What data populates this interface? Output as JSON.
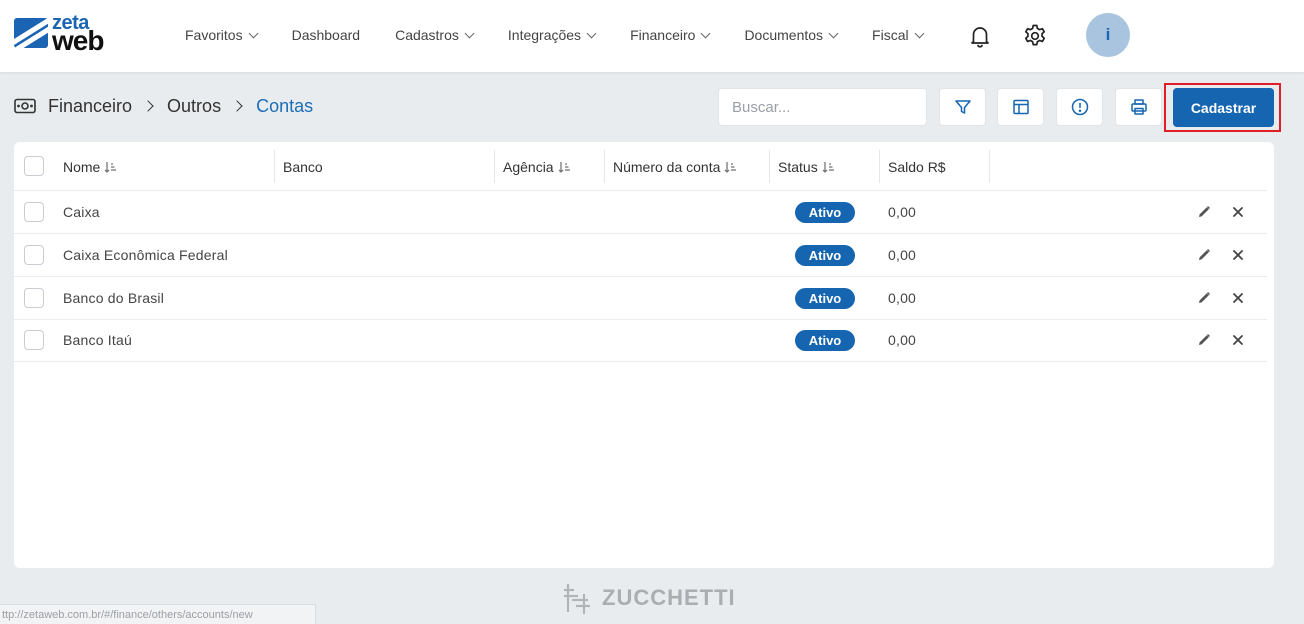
{
  "brand": {
    "line1": "zeta",
    "line2": "web"
  },
  "nav": {
    "items": [
      {
        "label": "Favoritos",
        "dropdown": true
      },
      {
        "label": "Dashboard",
        "dropdown": false
      },
      {
        "label": "Cadastros",
        "dropdown": true
      },
      {
        "label": "Integrações",
        "dropdown": true
      },
      {
        "label": "Financeiro",
        "dropdown": true
      },
      {
        "label": "Documentos",
        "dropdown": true
      },
      {
        "label": "Fiscal",
        "dropdown": true
      }
    ],
    "icons": [
      "bell-icon",
      "gear-icon"
    ],
    "avatar_initial": "i"
  },
  "breadcrumb": {
    "icon": "money-icon",
    "items": [
      "Financeiro",
      "Outros",
      "Contas"
    ]
  },
  "toolbar": {
    "search_placeholder": "Buscar...",
    "buttons": [
      "filter-icon",
      "layout-columns-icon",
      "info-icon",
      "print-icon"
    ],
    "primary_label": "Cadastrar"
  },
  "table": {
    "columns": [
      "Nome",
      "Banco",
      "Agência",
      "Número da conta",
      "Status",
      "Saldo R$"
    ],
    "rows": [
      {
        "nome": "Caixa",
        "banco": "",
        "agencia": "",
        "numero": "",
        "status": "Ativo",
        "saldo": "0,00"
      },
      {
        "nome": "Caixa Econômica Federal",
        "banco": "",
        "agencia": "",
        "numero": "",
        "status": "Ativo",
        "saldo": "0,00"
      },
      {
        "nome": "Banco do Brasil",
        "banco": "",
        "agencia": "",
        "numero": "",
        "status": "Ativo",
        "saldo": "0,00"
      },
      {
        "nome": "Banco Itaú",
        "banco": "",
        "agencia": "",
        "numero": "",
        "status": "Ativo",
        "saldo": "0,00"
      }
    ]
  },
  "footer": {
    "brand": "ZUCCHETTI"
  },
  "status_bar": {
    "url": "ttp://zetaweb.com.br/#/finance/others/accounts/new"
  },
  "colors": {
    "primary": "#1565b0",
    "highlight_frame": "#e01e26",
    "background": "#e9ecee"
  }
}
